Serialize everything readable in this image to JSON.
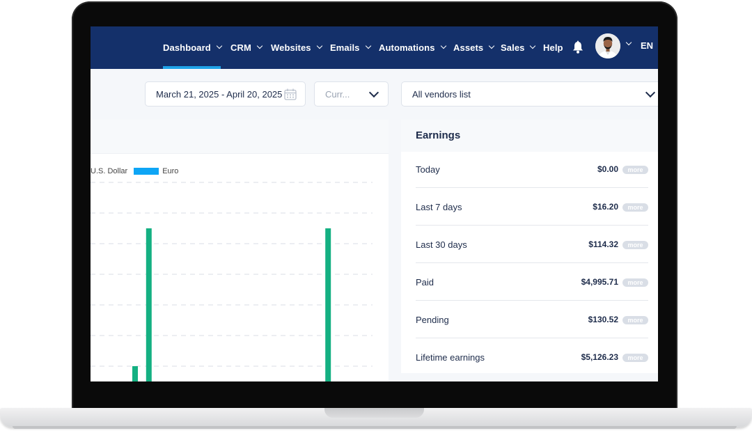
{
  "nav": {
    "items": [
      {
        "label": "Dashboard",
        "has_dropdown": true,
        "active": true
      },
      {
        "label": "CRM",
        "has_dropdown": true
      },
      {
        "label": "Websites",
        "has_dropdown": true
      },
      {
        "label": "Emails",
        "has_dropdown": true
      },
      {
        "label": "Automations",
        "has_dropdown": true
      },
      {
        "label": "Assets",
        "has_dropdown": true
      },
      {
        "label": "Sales",
        "has_dropdown": true
      },
      {
        "label": "Help",
        "has_dropdown": false
      }
    ],
    "language": "EN",
    "colors": {
      "background": "#14306a",
      "active_underline": "#1fa3e8"
    }
  },
  "filters": {
    "date_range": "March 21, 2025 - April 20, 2025",
    "currency_placeholder": "Curr...",
    "vendor": "All vendors list"
  },
  "chart_data": {
    "type": "bar",
    "legend": [
      {
        "name": "U.S. Dollar",
        "color": "#14b082"
      },
      {
        "name": "Euro",
        "color": "#0ea5f5"
      }
    ],
    "series": [
      {
        "name": "U.S. Dollar",
        "values": [
          {
            "day": 1,
            "value": 1
          },
          {
            "day": 2,
            "value": 5.5
          },
          {
            "day": 15,
            "value": 5.5
          }
        ]
      }
    ],
    "grid": true,
    "ylim": [
      0,
      13
    ]
  },
  "earnings": {
    "title": "Earnings",
    "more_label": "more",
    "rows": [
      {
        "label": "Today",
        "value": "$0.00"
      },
      {
        "label": "Last 7 days",
        "value": "$16.20"
      },
      {
        "label": "Last 30 days",
        "value": "$114.32"
      },
      {
        "label": "Paid",
        "value": "$4,995.71"
      },
      {
        "label": "Pending",
        "value": "$130.52"
      },
      {
        "label": "Lifetime earnings",
        "value": "$5,126.23"
      }
    ]
  }
}
